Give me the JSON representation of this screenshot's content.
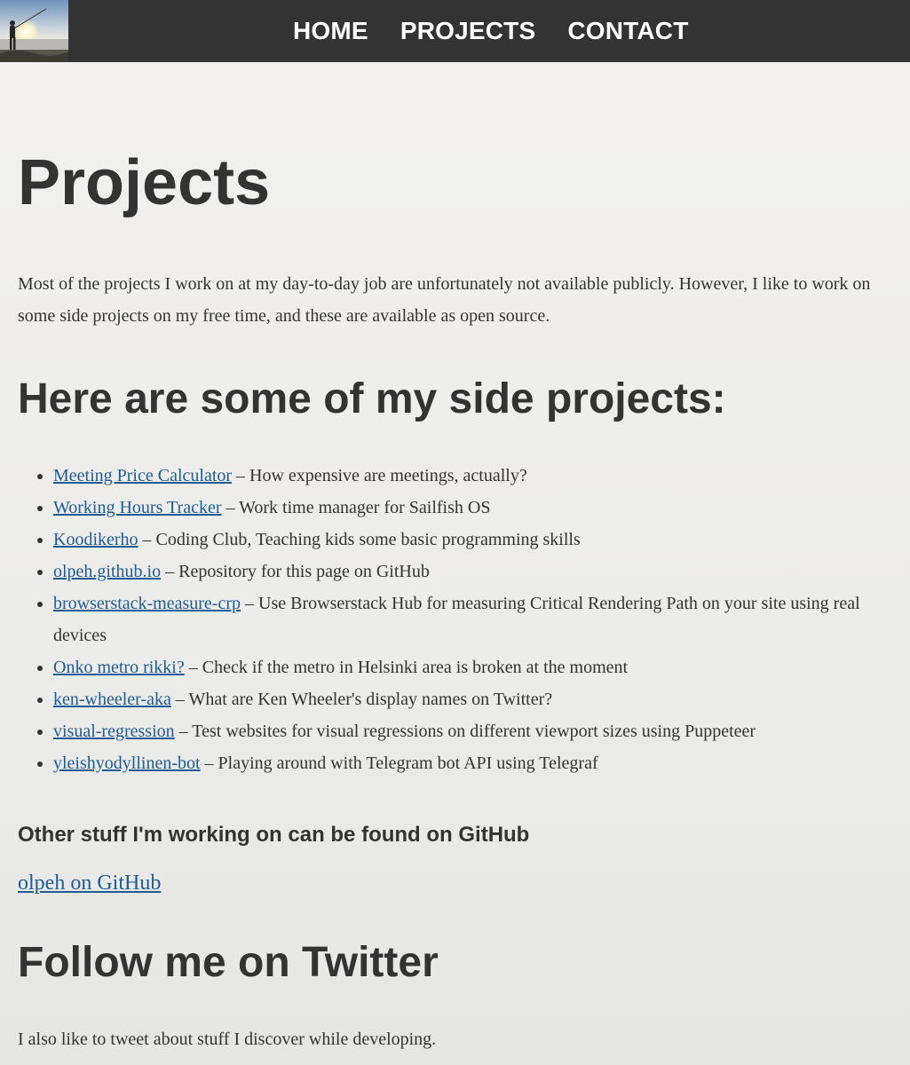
{
  "nav": {
    "items": [
      {
        "label": "HOME"
      },
      {
        "label": "PROJECTS"
      },
      {
        "label": "CONTACT"
      }
    ]
  },
  "page": {
    "title": "Projects",
    "intro": "Most of the projects I work on at my day-to-day job are unfortunately not available publicly. However, I like to work on some side projects on my free time, and these are available as open source.",
    "side_heading": "Here are some of my side projects:",
    "projects": [
      {
        "name": "Meeting Price Calculator",
        "desc": " – How expensive are meetings, actually?"
      },
      {
        "name": "Working Hours Tracker",
        "desc": " – Work time manager for Sailfish OS"
      },
      {
        "name": "Koodikerho",
        "desc": " – Coding Club, Teaching kids some basic programming skills"
      },
      {
        "name": "olpeh.github.io",
        "desc": " – Repository for this page on GitHub"
      },
      {
        "name": "browserstack-measure-crp",
        "desc": " – Use Browserstack Hub for measuring Critical Rendering Path on your site using real devices"
      },
      {
        "name": "Onko metro rikki?",
        "desc": " – Check if the metro in Helsinki area is broken at the moment"
      },
      {
        "name": "ken-wheeler-aka",
        "desc": " – What are Ken Wheeler's display names on Twitter?"
      },
      {
        "name": "visual-regression",
        "desc": " – Test websites for visual regressions on different viewport sizes using Puppeteer"
      },
      {
        "name": "yleishyodyllinen-bot",
        "desc": " – Playing around with Telegram bot API using Telegraf"
      }
    ],
    "other_heading": "Other stuff I'm working on can be found on GitHub",
    "github_link": "olpeh on GitHub",
    "follow_heading": "Follow me on Twitter",
    "tweet_text": "I also like to tweet about stuff I discover while developing."
  },
  "colors": {
    "topbar": "#333333",
    "link": "#1f5c93",
    "text": "#333333"
  },
  "icons": {
    "logo": "fisherman-sunset-photo"
  }
}
